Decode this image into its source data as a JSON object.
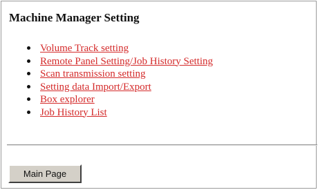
{
  "page": {
    "title": "Machine Manager Setting"
  },
  "menu": {
    "items": [
      {
        "label": "Volume Track setting"
      },
      {
        "label": "Remote Panel Setting/Job History Setting"
      },
      {
        "label": "Scan transmission setting"
      },
      {
        "label": "Setting data Import/Export"
      },
      {
        "label": "Box explorer"
      },
      {
        "label": "Job History List"
      }
    ]
  },
  "footer": {
    "main_page_label": "Main Page"
  },
  "colors": {
    "link": "#d42a2a",
    "button_face": "#d4d0c8"
  }
}
